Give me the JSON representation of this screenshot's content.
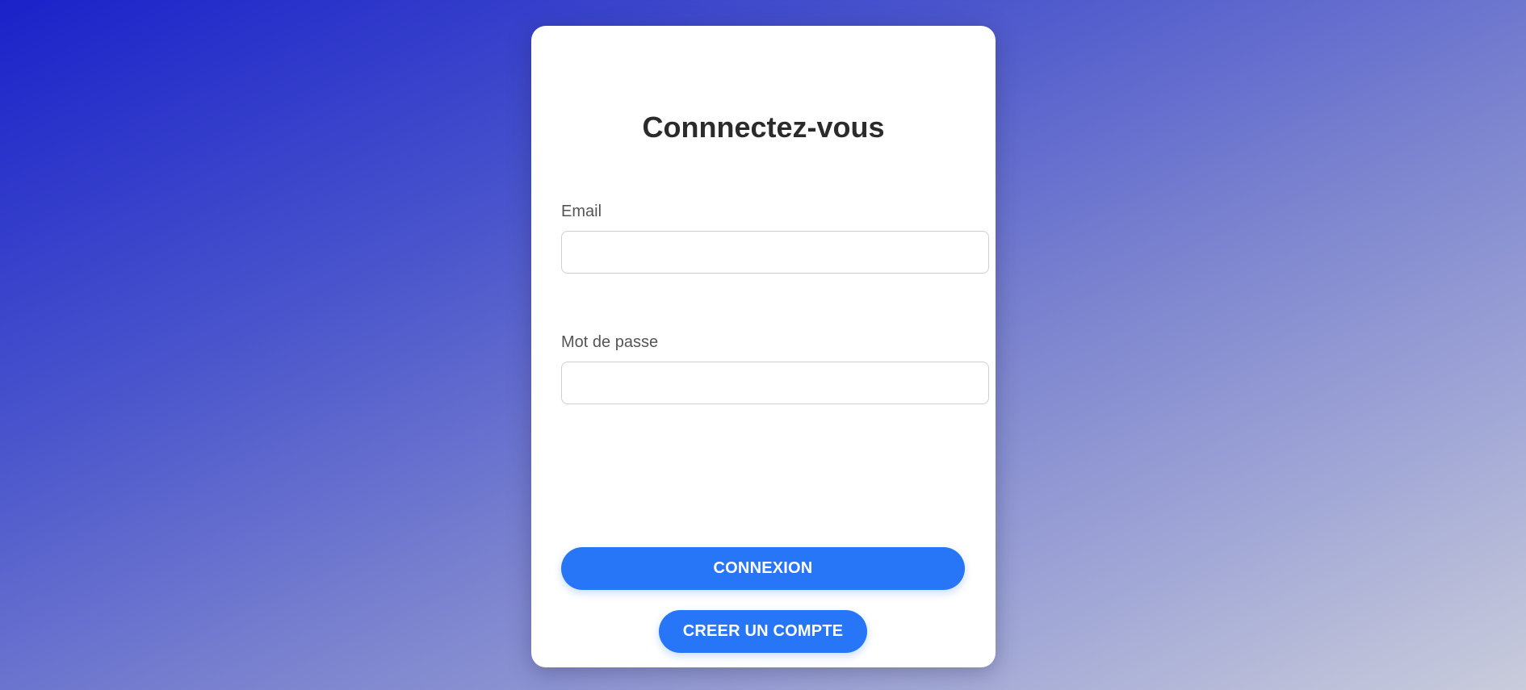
{
  "login_form": {
    "title": "Connnectez-vous",
    "email": {
      "label": "Email",
      "value": "",
      "placeholder": ""
    },
    "password": {
      "label": "Mot de passe",
      "value": "",
      "placeholder": ""
    },
    "login_button_label": "CONNEXION",
    "register_button_label": "CREER UN COMPTE"
  },
  "colors": {
    "accent": "#2776f7",
    "card_background": "#ffffff",
    "title_text": "#2b2b2b",
    "label_text": "#555555",
    "background_gradient_start": "#1a22c9",
    "background_gradient_end": "#c9ccdb"
  }
}
